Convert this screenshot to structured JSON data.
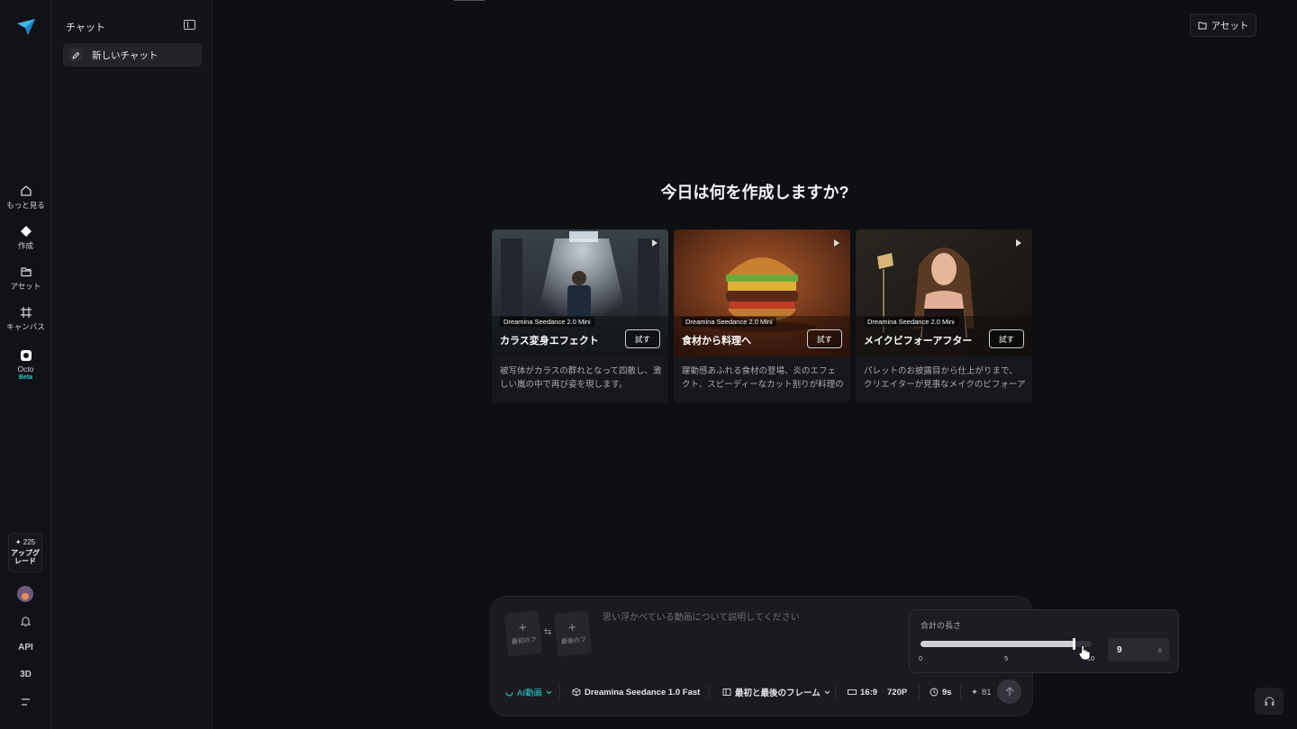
{
  "rail": {
    "items": [
      {
        "label": "もっと見る",
        "icon": "home-icon"
      },
      {
        "label": "作成",
        "icon": "diamond-icon"
      },
      {
        "label": "アセット",
        "icon": "folder-icon"
      },
      {
        "label": "キャンバス",
        "icon": "canvas-icon"
      },
      {
        "label": "Octo",
        "icon": "octo-icon",
        "badge": "Beta"
      }
    ],
    "credits": "225",
    "upgrade_label": "アップグレード",
    "bottom": [
      "API",
      "3D"
    ]
  },
  "chat_panel": {
    "title": "チャット",
    "new_chat": "新しいチャット"
  },
  "header": {
    "asset_button": "アセット"
  },
  "main": {
    "heading": "今日は何を作成しますか?",
    "cards": [
      {
        "badge": "Dreamina Seedance 2.0 Mini",
        "title": "カラス変身エフェクト",
        "button": "試す",
        "description": "被写体がカラスの群れとなって四散し、激しい嵐の中で再び姿を現します。"
      },
      {
        "badge": "Dreamina Seedance 2.0 Mini",
        "title": "食材から料理へ",
        "button": "試す",
        "description": "躍動感あふれる食材の登場、炎のエフェクト、スピーディーなカット割りが料理のス..."
      },
      {
        "badge": "Dreamina Seedance 2.0 Mini",
        "title": "メイクビフォーアフター",
        "button": "試す",
        "description": "パレットのお披露目から仕上がりまで、クリエイターが見事なメイクのビフォーアフ..."
      }
    ]
  },
  "prompt": {
    "first_frame": "最初のフ",
    "last_frame": "最後のフ",
    "placeholder": "思い浮かべている動画について説明してください",
    "mode": "AI動画",
    "model": "Dreamina Seedance 1.0 Fast",
    "frames_mode": "最初と最後のフレーム",
    "ratio": "16:9",
    "resolution": "720P",
    "duration": "9s",
    "cost": "81"
  },
  "duration_popover": {
    "label": "合計の長さ",
    "value": "9",
    "unit": "s",
    "min": 0,
    "max": 10,
    "current": 9,
    "ticks": [
      "0",
      "5",
      "10"
    ]
  },
  "colors": {
    "accent": "#2bd0d0",
    "background": "#0e0f13"
  }
}
